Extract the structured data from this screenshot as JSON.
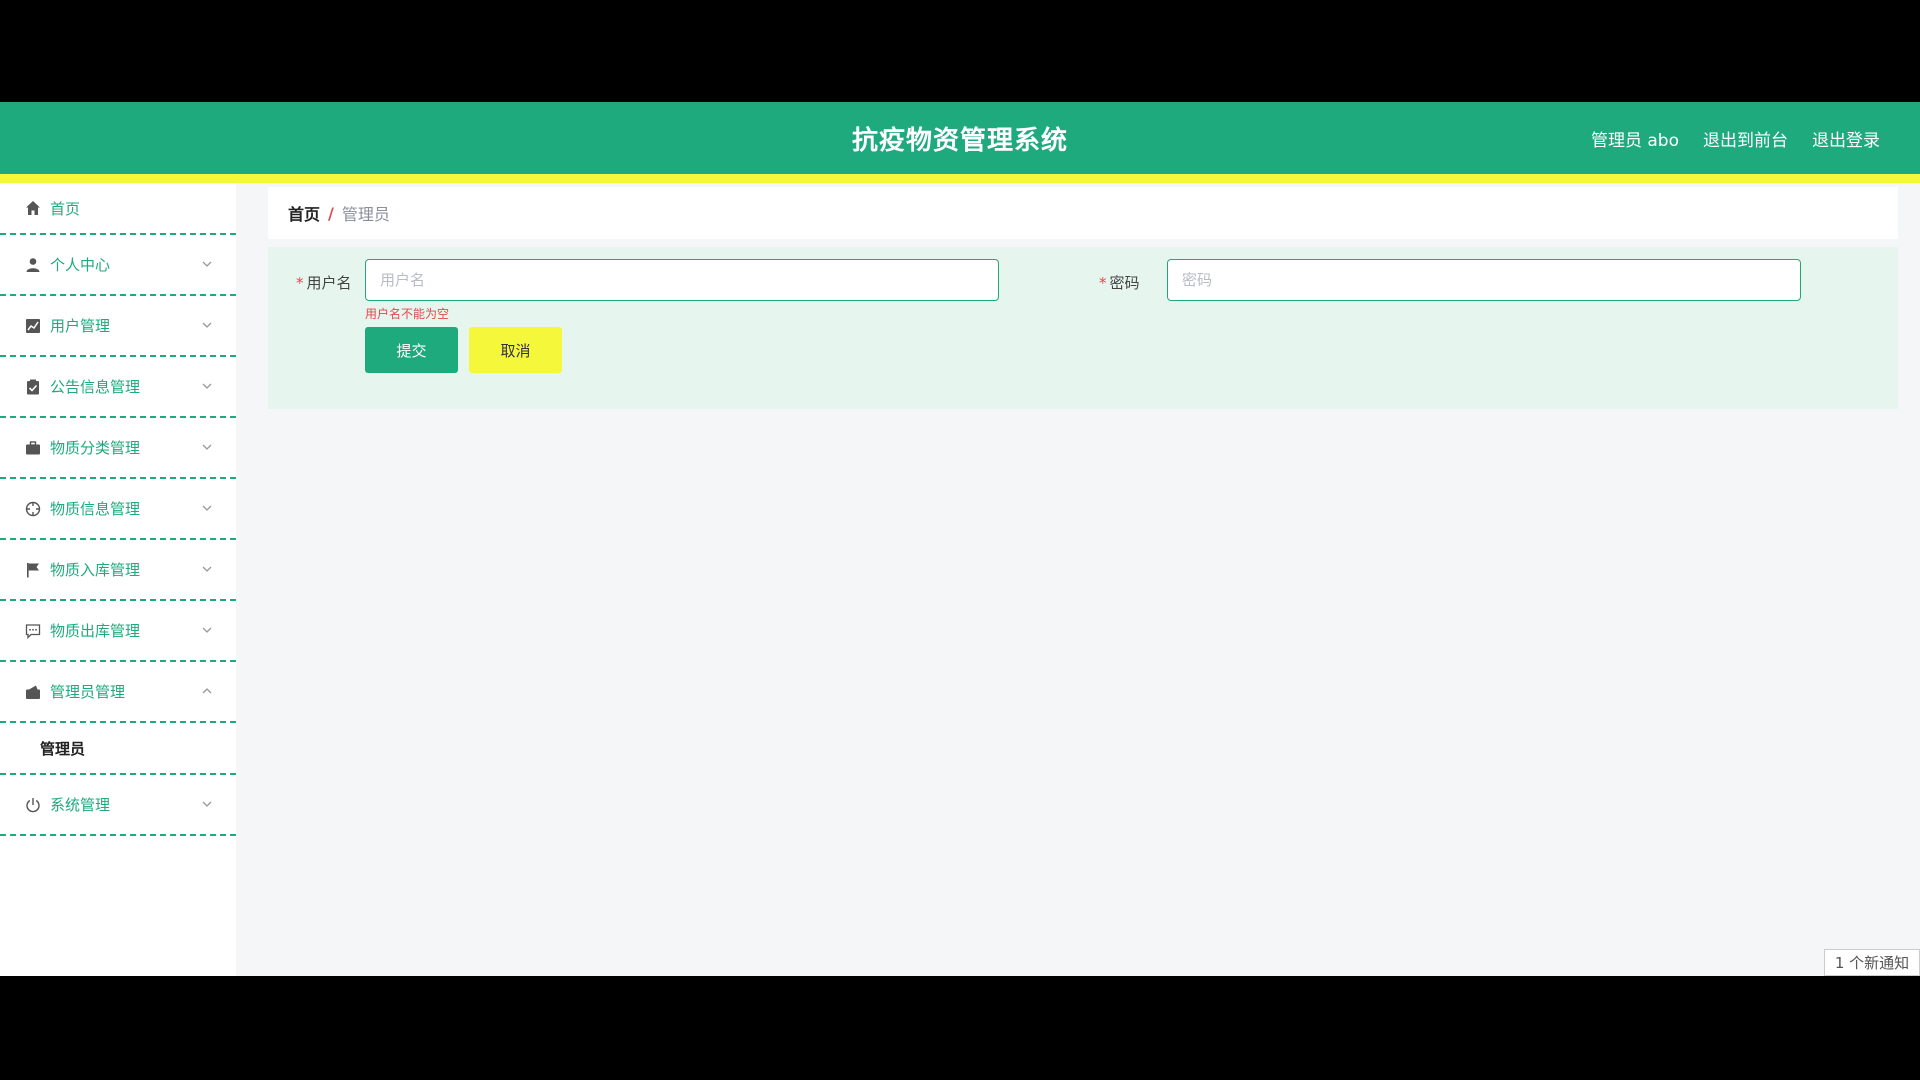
{
  "header": {
    "title": "抗疫物资管理系统",
    "user_label": "管理员 abo",
    "front_link": "退出到前台",
    "logout_link": "退出登录"
  },
  "sidebar": {
    "items": [
      {
        "label": "首页",
        "icon": "home-icon"
      },
      {
        "label": "个人中心",
        "icon": "user-icon"
      },
      {
        "label": "用户管理",
        "icon": "chart-icon"
      },
      {
        "label": "公告信息管理",
        "icon": "clipboard-icon"
      },
      {
        "label": "物质分类管理",
        "icon": "briefcase-icon"
      },
      {
        "label": "物质信息管理",
        "icon": "compass-icon"
      },
      {
        "label": "物质入库管理",
        "icon": "flag-icon"
      },
      {
        "label": "物质出库管理",
        "icon": "message-icon"
      },
      {
        "label": "管理员管理",
        "icon": "wallet-icon"
      },
      {
        "label": "系统管理",
        "icon": "power-icon"
      }
    ],
    "submenu_label": "管理员"
  },
  "breadcrumb": {
    "home": "首页",
    "separator": "/",
    "current": "管理员"
  },
  "form": {
    "username_label": "用户名",
    "username_placeholder": "用户名",
    "username_value": "",
    "username_error": "用户名不能为空",
    "password_label": "密码",
    "password_placeholder": "密码",
    "password_value": "",
    "required_mark": "*",
    "submit_label": "提交",
    "cancel_label": "取消"
  },
  "notice": "1 个新通知",
  "colors": {
    "primary": "#1eaa7d",
    "accent_yellow": "#f5f73b",
    "error": "#e2484d"
  }
}
